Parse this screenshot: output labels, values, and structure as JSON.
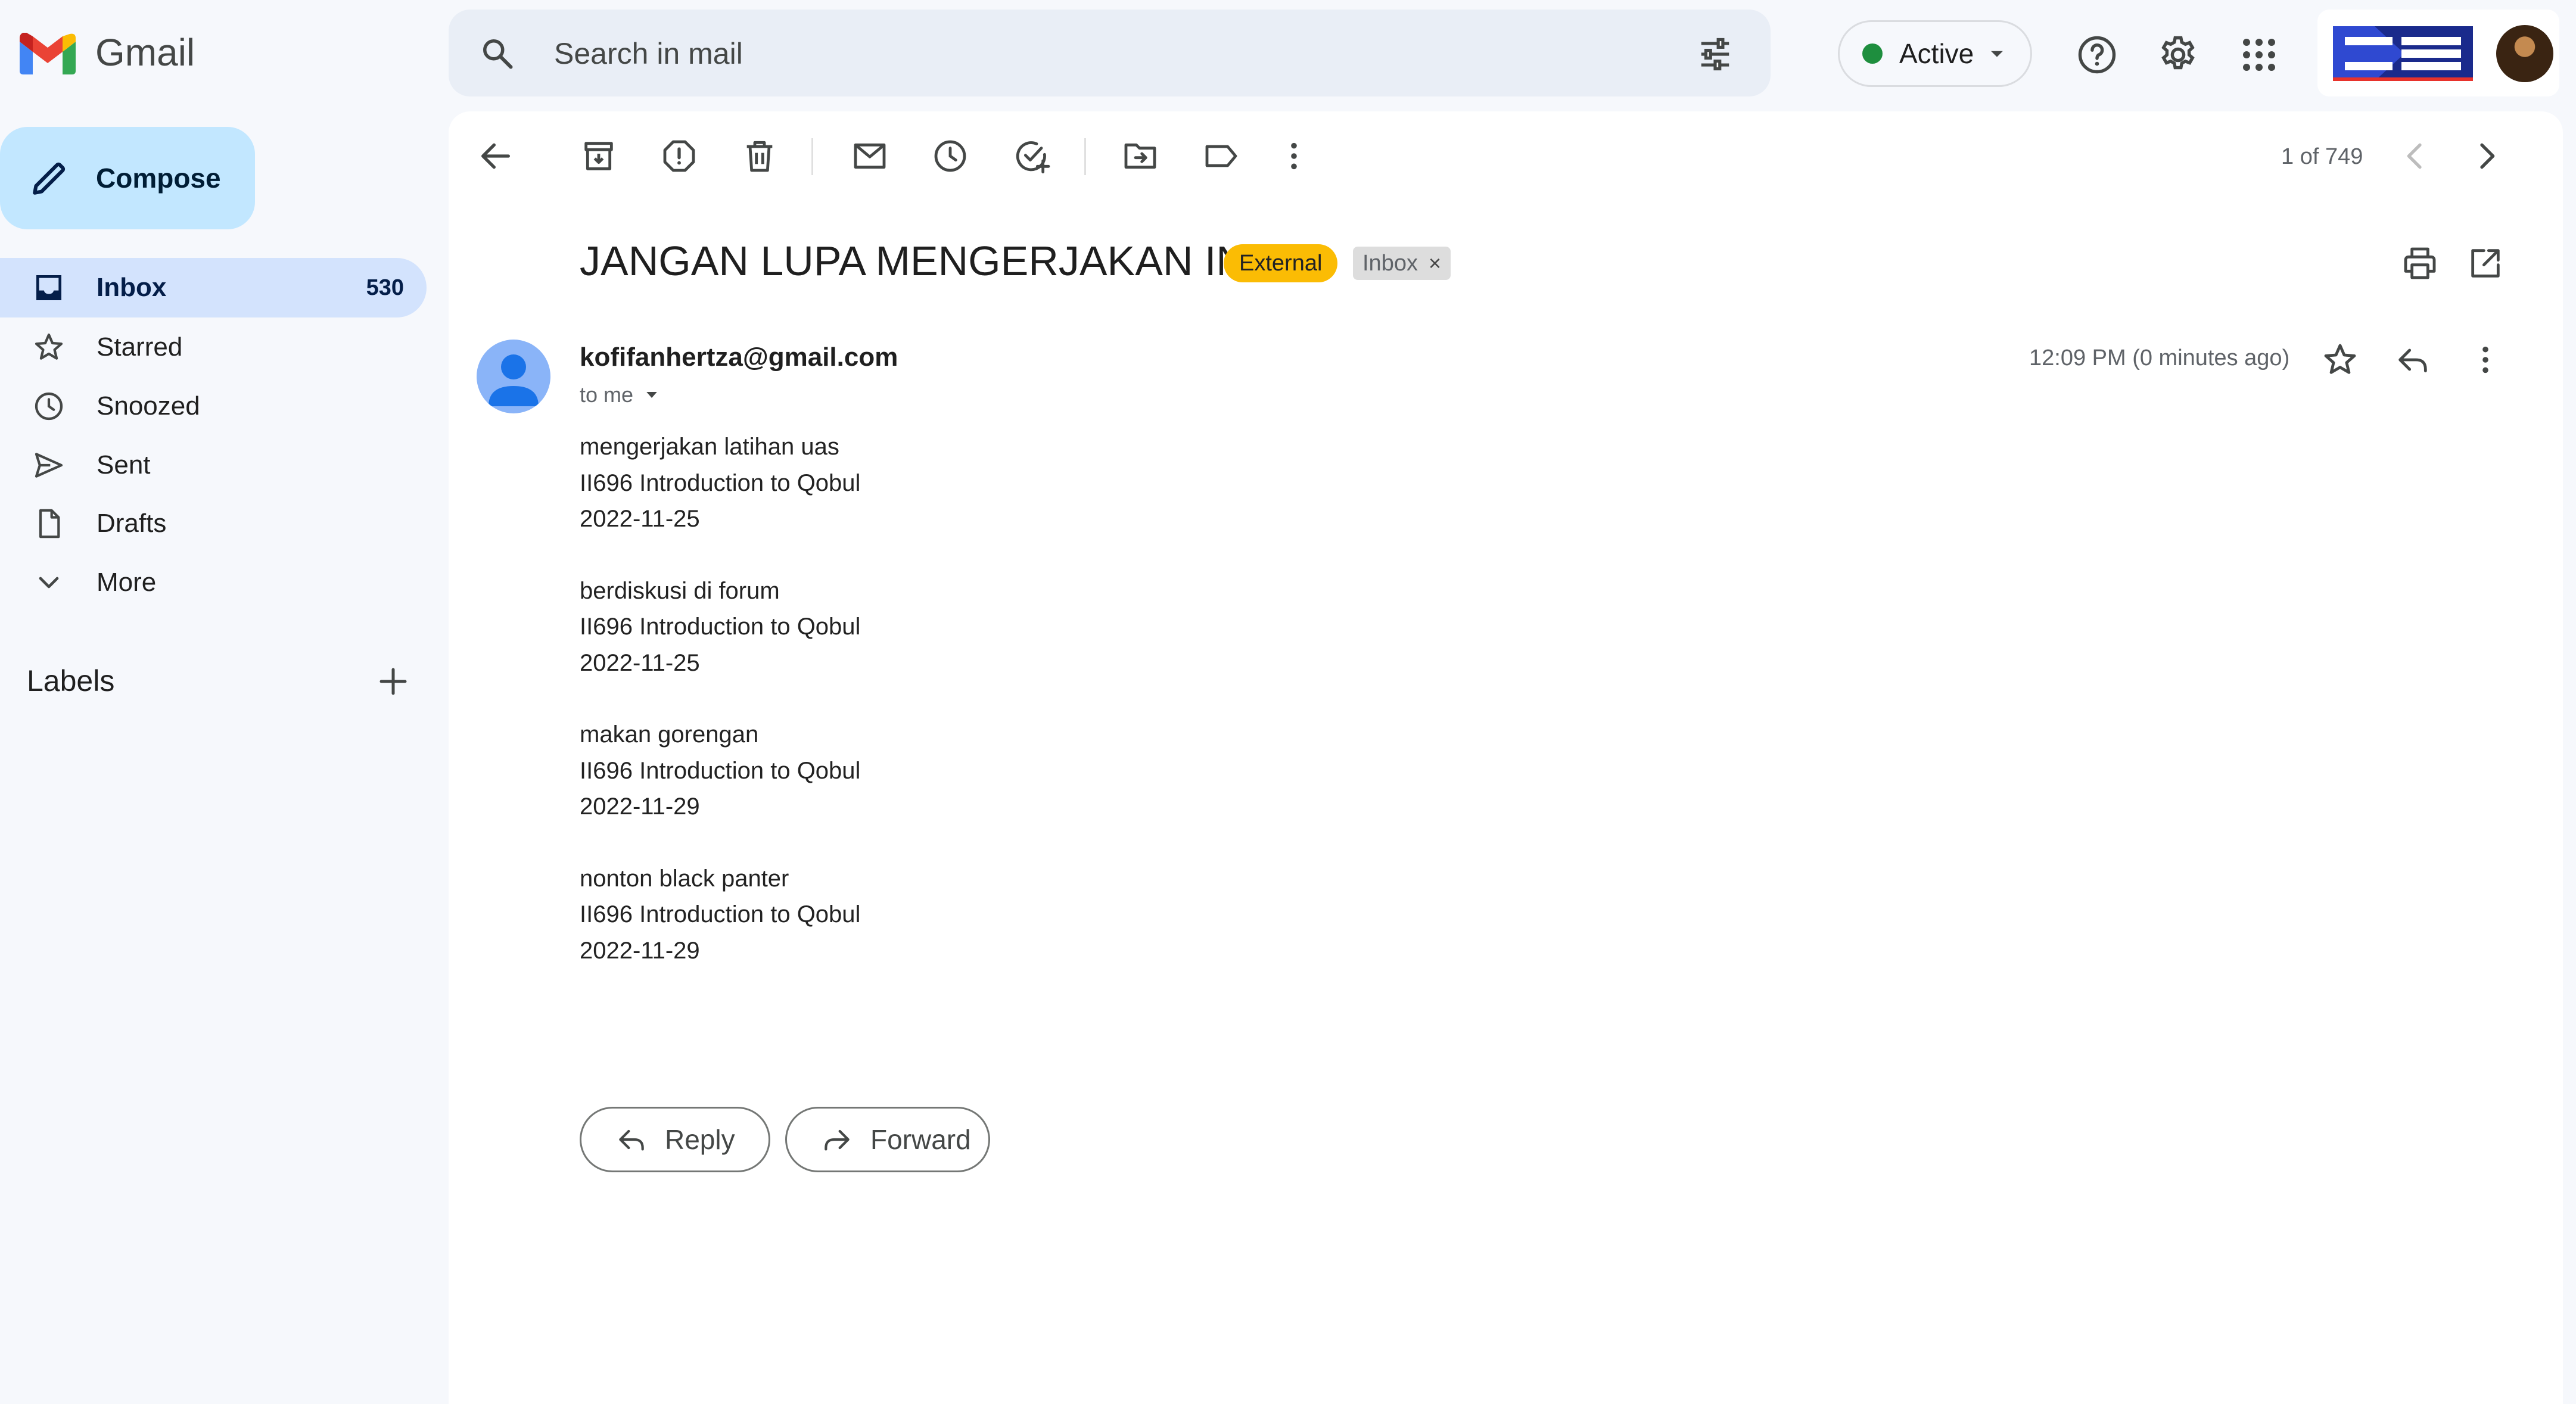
{
  "app": {
    "name": "Gmail",
    "brand_colors": {
      "red": "#ea4335",
      "blue": "#4285f4",
      "yellow": "#fbbc04",
      "green": "#34a853"
    }
  },
  "search": {
    "placeholder": "Search in mail",
    "icon": "search-icon",
    "filter_icon": "tune-icon"
  },
  "status": {
    "label": "Active",
    "color": "#1e8e3e"
  },
  "header_icons": [
    "help-icon",
    "gear-icon",
    "apps-grid-icon"
  ],
  "sidebar": {
    "compose_label": "Compose",
    "items": [
      {
        "label": "Inbox",
        "count": "530",
        "icon": "inbox-icon",
        "selected": true
      },
      {
        "label": "Starred",
        "icon": "star-icon"
      },
      {
        "label": "Snoozed",
        "icon": "clock-icon"
      },
      {
        "label": "Sent",
        "icon": "send-icon"
      },
      {
        "label": "Drafts",
        "icon": "draft-icon"
      },
      {
        "label": "More",
        "icon": "chevron-down-icon"
      }
    ],
    "labels_title": "Labels"
  },
  "toolbar": {
    "icons": [
      "back-arrow-icon",
      "archive-icon",
      "report-spam-icon",
      "trash-icon",
      "mark-unread-icon",
      "snooze-icon",
      "add-task-icon",
      "move-to-icon",
      "label-icon",
      "more-vert-icon"
    ],
    "count": "1 of 749"
  },
  "email": {
    "subject": "JANGAN LUPA MENGERJAKAN INI",
    "tag_external": "External",
    "tag_inbox": "Inbox",
    "sender": "kofifanhertza@gmail.com",
    "to": "to me",
    "time": "12:09 PM (0 minutes ago)",
    "body": [
      {
        "task": "mengerjakan latihan uas",
        "course": "II696 Introduction to Qobul",
        "date": "2022-11-25"
      },
      {
        "task": "berdiskusi di forum",
        "course": "II696 Introduction to Qobul",
        "date": "2022-11-25"
      },
      {
        "task": "makan gorengan",
        "course": "II696 Introduction to Qobul",
        "date": "2022-11-29"
      },
      {
        "task": "nonton black panter",
        "course": "II696 Introduction to Qobul",
        "date": "2022-11-29"
      }
    ]
  },
  "actions": {
    "reply_label": "Reply",
    "forward_label": "Forward"
  }
}
